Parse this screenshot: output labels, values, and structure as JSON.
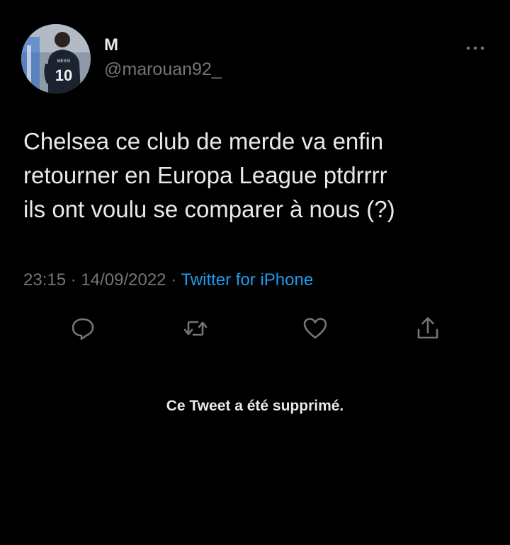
{
  "author": {
    "display_name": "M",
    "handle": "@marouan92_",
    "avatar": "player-avatar-icon"
  },
  "tweet": {
    "lines": [
      "Chelsea ce club de merde va enfin",
      "retourner en Europa League ptdrrrr",
      "ils ont voulu se comparer à nous (?)"
    ],
    "time": "23:15",
    "separator": "·",
    "date": "14/09/2022",
    "source": "Twitter for iPhone"
  },
  "actions": [
    {
      "name": "reply",
      "icon": "reply-icon"
    },
    {
      "name": "retweet",
      "icon": "retweet-icon"
    },
    {
      "name": "like",
      "icon": "heart-icon"
    },
    {
      "name": "share",
      "icon": "share-icon"
    }
  ],
  "notice": "Ce Tweet a été supprimé.",
  "colors": {
    "background": "#000000",
    "text": "#e7e9ea",
    "muted": "#71767b",
    "link": "#1d9bf0"
  }
}
